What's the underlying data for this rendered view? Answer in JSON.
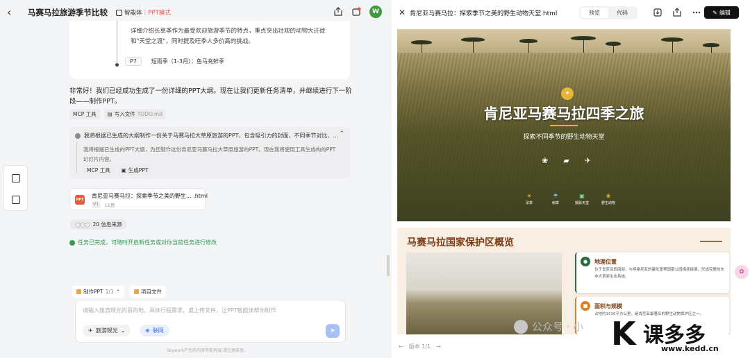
{
  "chat": {
    "title": "马赛马拉旅游季节比较",
    "agent_label": "智能体",
    "mode_label": "PPT模式",
    "avatar_initial": "W",
    "outline": {
      "text": "详细介绍长草季作为最受欢迎旅游季节的特点，重点突出壮观的动物大迁徙和\"天堂之渡\"，同时提及旺季人多价高的挑战。",
      "item_page": "P7",
      "item_title": "短雨季（1-3月）：鱼马充鲜季"
    },
    "message": "非常好！我们已经成功生成了一份详细的PPT大纲。现在让我们更新任务清单，并继续进行下一阶段——制作PPT。",
    "tools": [
      {
        "label": "MCP 工具"
      },
      {
        "label": "写入文件",
        "sub": "TODO.md"
      }
    ],
    "thinking": {
      "header": "我将根据已生成的大纲制作一份关于马赛马拉大草原旅游的PPT，包含吸引力的封面、不同季节对比、...",
      "body": "我将根据已生成的PPT大纲，为您制作这份肯尼亚马赛马拉大草原旅游的PPT。现在我将使用工具生成构的PPT幻灯片内容。",
      "tools": [
        {
          "label": "MCP 工具"
        },
        {
          "label": "生成PPT"
        }
      ]
    },
    "file_card": {
      "icon_text": "PPT",
      "name": "肯尼亚马赛马拉：探索季节之美的野生... .html",
      "version": "V1",
      "pages": "11页"
    },
    "sources_label": "20 信息来源",
    "done_text": "任务已完成，可随时开启新任务或对你当前任务进行修改",
    "bottom_tabs": [
      {
        "label": "制作PPT",
        "sub": "1/1"
      },
      {
        "label": "项目文件"
      }
    ],
    "composer": {
      "placeholder": "请输入旅游规光的目的地、具体行程需求、或上传文件，让PPT智能体帮你制作",
      "chip_travel": "旅游规光",
      "chip_web": "联网"
    },
    "disclaimer": "Skywork产生的内容可能有误,请注意核查。"
  },
  "preview": {
    "file_title": "肯尼亚马赛马拉：探索季节之美的野生动物天堂.html",
    "tab_preview": "预览",
    "tab_code": "代码",
    "edit_label": "编辑",
    "hero": {
      "title": "肯尼亚马赛马拉四季之旅",
      "subtitle": "探索不同季节的野生动物天堂",
      "seasons": [
        "旱季",
        "雨季",
        "摄影天堂",
        "野生动物"
      ]
    },
    "section": {
      "title": "马赛马拉国家保护区概览",
      "cards": [
        {
          "title": "地理位置",
          "text": "位于肯尼亚西南部，与坦桑尼亚的塞伦盖蒂国家公园相连接壤，形成完整的东非大草原生态系统。"
        },
        {
          "title": "面积与规模",
          "text": "占地约1510平方公里，是肯尼亚最著名的野生动物保护区之一。"
        }
      ]
    },
    "footer_version": "版本 1/1"
  },
  "watermark": {
    "gzh": "公众号 · 小",
    "brand": "课多多",
    "url": "www.kedd.cn"
  },
  "colors": {
    "accent": "#e0534a",
    "success": "#2d9d52",
    "section_title": "#7c3b12",
    "hero_badge": "#e9b534"
  }
}
